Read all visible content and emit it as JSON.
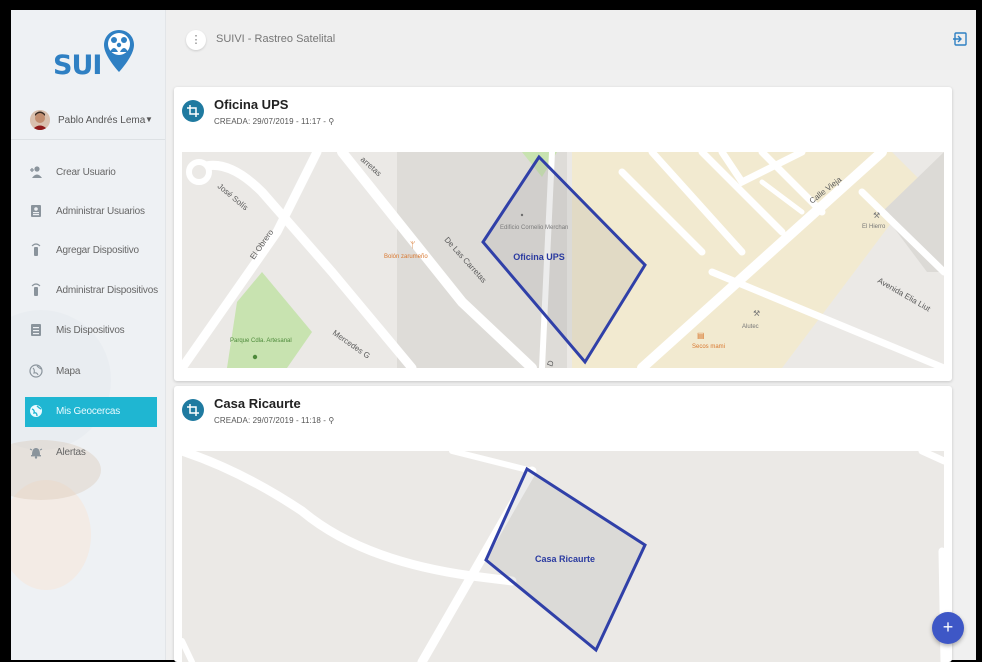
{
  "app": {
    "logo_text": "SUI",
    "title": "SUIVI - Rastreo Satelital"
  },
  "user": {
    "name": "Pablo Andrés Lema"
  },
  "sidebar": {
    "items": [
      {
        "label": "Crear Usuario",
        "icon": "add-user-icon"
      },
      {
        "label": "Administrar Usuarios",
        "icon": "id-badge-icon"
      },
      {
        "label": "Agregar Dispositivo",
        "icon": "device-icon"
      },
      {
        "label": "Administrar Dispositivos",
        "icon": "device-icon"
      },
      {
        "label": "Mis Dispositivos",
        "icon": "id-badge-icon"
      },
      {
        "label": "Mapa",
        "icon": "globe-icon"
      },
      {
        "label": "Mis Geocercas",
        "icon": "geofence-icon",
        "active": true
      },
      {
        "label": "Alertas",
        "icon": "bell-icon"
      }
    ]
  },
  "geofences": [
    {
      "name": "Oficina UPS",
      "created": "CREADA: 29/07/2019 - 11:17 - ⚲",
      "polygon_label": "Oficina UPS",
      "map_labels": {
        "s1": "José Solís",
        "s2": "El Obrero",
        "s3": "De Las Carretas",
        "s4": "Mercedes G",
        "s5": "Calle Vieja",
        "s6": "Avenida Elia Liut",
        "s7": "arretas",
        "p1": "Bolón zarumeño",
        "p2": "Parque Cdla. Artesanal",
        "p3": "Edificio Cornelio Merchan",
        "p4": "El Hierro",
        "p5": "Alutec",
        "p6": "Secos mami",
        "p7": "D"
      }
    },
    {
      "name": "Casa Ricaurte",
      "created": "CREADA: 29/07/2019 - 11:18 - ⚲",
      "polygon_label": "Casa Ricaurte"
    }
  ],
  "colors": {
    "accent": "#1fb6d2",
    "brand": "#2f80c3",
    "geofence_stroke": "#3040a8",
    "fab": "#3e57c6"
  }
}
